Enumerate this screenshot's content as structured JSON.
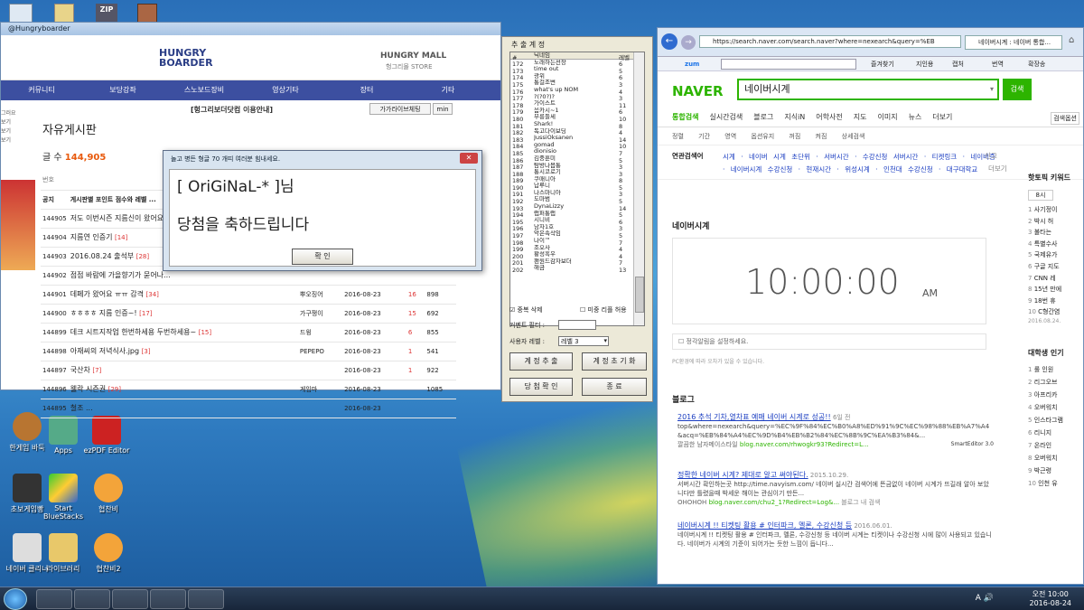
{
  "desktop": {
    "top_icon_zip": "ZIP",
    "icons": [
      {
        "label": "한게임 바둑"
      },
      {
        "label": "Apps"
      },
      {
        "label": "ezPDF Editor"
      },
      {
        "label": "초보게임빵"
      },
      {
        "label": "Start BlueStacks"
      },
      {
        "label": "협찬비"
      },
      {
        "label": "네이버 클리너"
      },
      {
        "label": "라이브러리"
      },
      {
        "label": "협찬비2"
      }
    ]
  },
  "taskbar": {
    "time": "오전 10:00",
    "date": "2016-08-24",
    "tray": "A 🔊 "
  },
  "left_window": {
    "title": "@Hungryboarder",
    "logo": "HUNGRY BOARDER",
    "mall": "HUNGRY MALL",
    "mall_sub": "헝그리몰 STORE",
    "menu": [
      "커뮤니티",
      "보당강좌",
      "스노보드장비",
      "영상기타",
      "장터",
      "기타"
    ],
    "notice": "[헝그리보더닷컴 이용안내]",
    "btn_guide": "가가라이브체팅",
    "btn_min": "min",
    "board_title": "자유게시판",
    "count_label": "글 수",
    "count_value": "144,905",
    "side_labels": [
      "그러요",
      "보기",
      "보기",
      "보기"
    ],
    "col_num": "번호",
    "notice_row": {
      "num": "공지",
      "title": "게시판별 포인트 점수와 레벨 ..."
    },
    "rows": [
      {
        "num": "144905",
        "title": "저도 이번시즌 지름신이 왔어요",
        "cmt": "",
        "author": "",
        "date": "",
        "rec": "",
        "views": ""
      },
      {
        "num": "144904",
        "title": "지름연 인증기",
        "cmt": "[14]",
        "author": "",
        "date": "",
        "rec": "",
        "views": ""
      },
      {
        "num": "144903",
        "title": "2016.08.24 출석부",
        "cmt": "[28]",
        "author": "",
        "date": "",
        "rec": "",
        "views": ""
      },
      {
        "num": "144902",
        "title": "점점 바람에 가을향기가 묻어나...",
        "cmt": "",
        "author": "",
        "date": "",
        "rec": "",
        "views": ""
      },
      {
        "num": "144901",
        "title": "데페가 왔어요 ㅠㅠ 감격",
        "cmt": "[34]",
        "author": "뿌오징어",
        "date": "2016-08-23",
        "rec": "16",
        "views": "898"
      },
      {
        "num": "144900",
        "title": "ㅎㅎㅎㅎ 지름 인증~!",
        "cmt": "[17]",
        "author": "가구쟁이",
        "date": "2016-08-23",
        "rec": "15",
        "views": "692"
      },
      {
        "num": "144899",
        "title": "데크 시트지작업 한번하세용 두번하세용~",
        "cmt": "[15]",
        "author": "드윙",
        "date": "2016-08-23",
        "rec": "6",
        "views": "855"
      },
      {
        "num": "144898",
        "title": "아재씨의 저녁식사.jpg",
        "cmt": "[3]",
        "author": "PEPEPO",
        "date": "2016-08-23",
        "rec": "1",
        "views": "541"
      },
      {
        "num": "144897",
        "title": "국산차",
        "cmt": "[7]",
        "author": "",
        "date": "2016-08-23",
        "rec": "1",
        "views": "922"
      },
      {
        "num": "144896",
        "title": "웰락 시즌권",
        "cmt": "[29]",
        "author": "게임마",
        "date": "2016-08-23",
        "rec": "",
        "views": "1085"
      },
      {
        "num": "144895",
        "title": "철조 ...",
        "cmt": "",
        "author": "",
        "date": "2016-08-23",
        "rec": "",
        "views": ""
      }
    ]
  },
  "extractor": {
    "title": "추 출 계 정",
    "col_no": "#",
    "col_name": "닉네임",
    "col_level": "레벨",
    "list": [
      [
        "172",
        "노래하는선장",
        "6"
      ],
      [
        "173",
        "time out",
        "5"
      ],
      [
        "174",
        "광위",
        "6"
      ],
      [
        "175",
        "통걸조변",
        "3"
      ],
      [
        "176",
        "what's up NOM",
        "4"
      ],
      [
        "177",
        "?(?0?)?",
        "3"
      ],
      [
        "178",
        "가이스트",
        "11"
      ],
      [
        "179",
        "음카시~1",
        "6"
      ],
      [
        "180",
        "부릉들세",
        "10"
      ],
      [
        "181",
        "Shark!",
        "8"
      ],
      [
        "182",
        "독고다이보딩",
        "4"
      ],
      [
        "183",
        "JussiOksanen",
        "14"
      ],
      [
        "184",
        "gomad",
        "10"
      ],
      [
        "185",
        "dionisio",
        "7"
      ],
      [
        "186",
        "김중훈미",
        "5"
      ],
      [
        "187",
        "탐방나봅통",
        "3"
      ],
      [
        "188",
        "통시코로기",
        "3"
      ],
      [
        "189",
        "쿠매니아",
        "8"
      ],
      [
        "190",
        "납루니",
        "5"
      ],
      [
        "191",
        "나스마니아",
        "3"
      ],
      [
        "192",
        "도마범",
        "5"
      ],
      [
        "193",
        "DynaLizzy",
        "14"
      ],
      [
        "194",
        "랩퍼통랩",
        "5"
      ],
      [
        "195",
        "시니비",
        "6"
      ],
      [
        "196",
        "남자1호",
        "3"
      ],
      [
        "197",
        "악은속삭임",
        "5"
      ],
      [
        "198",
        "나이™",
        "7"
      ],
      [
        "199",
        "조오사",
        "4"
      ],
      [
        "200",
        "황성흑우",
        "4"
      ],
      [
        "201",
        "팬원드감자보더",
        "7"
      ],
      [
        "202",
        "해금",
        "13"
      ]
    ],
    "chk_dup": "중복 삭제",
    "chk_exclude": "미중 리플 허용",
    "filter_label": "커멘트 필터 :",
    "level_label": "사용자 레벨 :",
    "level_value": "레벨 3",
    "btn_extract": "계 정 추 출",
    "btn_reset": "계 정 초 기 화",
    "btn_confirm": "당 첨 확 인",
    "btn_end": "종 료"
  },
  "dialog": {
    "title": "놀고 병든 형글 70 개띠 여러분 힘내세요.",
    "winner": "[ OriGiNaL-* ]님",
    "message": "당첨을 축하드립니다",
    "ok": "확 인"
  },
  "browser": {
    "url": "https://search.naver.com/search.naver?where=nexearch&query=%EB",
    "tab": "네이버시계 : 네이버 통합...",
    "zum": "zum",
    "fav": "즐겨찾기",
    "fav2": "지인용",
    "capture": "캡처",
    "translate": "번역",
    "ext": "확장송",
    "logo": "NAVER",
    "query": "네이버시계",
    "search_btn": "검색",
    "tabs": [
      "통합검색",
      "실시간검색",
      "블로그",
      "지식iN",
      "어학사전",
      "지도",
      "이미지",
      "뉴스",
      "더보기"
    ],
    "tab_right": "검색옵션",
    "filters": [
      "정렬",
      "기간",
      "영역",
      "옵션유지",
      "꺼짐",
      "켜짐",
      "상세검색"
    ],
    "related_label": "연관검색어",
    "related": [
      "시계",
      "네이버 시계 초단위",
      "서버시간",
      "수강신청 서버시간",
      "티켓링크",
      "네이버증",
      "네이버시계 수강신청",
      "현재시간",
      "위성시계",
      "인천대 수강신청",
      "대구대학교"
    ],
    "report": "신고",
    "more": "더보기",
    "clock_title": "네이버시계",
    "clock_time": "10:00:00",
    "clock_ampm": "AM",
    "alarm": "정각알림을 설정하세요.",
    "clock_note": "PC환경에 따라 오차가 있을 수 있습니다.",
    "blog_label": "블로그",
    "blogs": [
      {
        "title": "2016 추석 기차,열차표 예매 네이버 시계로 성공!!",
        "meta": "6일 전",
        "body": "top&where=nexearch&query=%EC%9F%84%EC%B0%A8%ED%91%9C%EC%98%88%EB%A7%A4&acq=%EB%84%A4%EC%9D%B4%EB%B2%84%EC%8B%9C%EA%B3%84&...",
        "src": "깔끔한 남자메이스타일",
        "url": "blog.naver.com/rhwogkr93?Redirect=L...",
        "badge": "SmartEditor 3.0"
      },
      {
        "title": "정확한 네이버 시계? 제대로 알고 써야된다.",
        "meta": "2015.10.29.",
        "body": "서버시간 확인하는곳 http://time.navyism.com/ 네이버 실시간 검색어에 뜬금없이 네이버 시계가 뜨길래 알아 보았니다만 틀렸을때 박세운 해이는 관심이기 만든...",
        "src": "OHOHOH",
        "url": "blog.naver.com/chu2_1?Redirect=Log&...",
        "badge": "블로그 내 검색"
      },
      {
        "title": "네이버시계 !! 티켓팅 활용 # 인터파크, 멜론, 수강신청 등",
        "meta": "2016.06.01.",
        "body": "네이버시계 !! 티켓팅 활용 # 인터파크, 멜론, 수강신청 등 네이버 시계는 티켓이나 수강신청 시에 많이 사용되고 있습니다. 네이버가 시계의 기준이 되어가는 듯한 느낌이 듭니다...",
        "src": "",
        "url": "",
        "badge": ""
      }
    ],
    "side_title": "핫토픽 키워드",
    "side_tab": "8시",
    "side_items": [
      "사기정이",
      "박시 허",
      "불타는",
      "특별수사",
      "국제유가",
      "구글 지도",
      "CNN 레",
      "15년 만에",
      "18번 휴",
      "C형간염"
    ],
    "side_date": "2016.08.24.",
    "side2_title": "대학생 인기",
    "side2_items": [
      "롤 인원",
      "리그오브",
      "아프리카",
      "오버워치",
      "인스타그램",
      "리니지",
      "온라인",
      "오버워치",
      "박근령",
      "인천 유"
    ]
  }
}
